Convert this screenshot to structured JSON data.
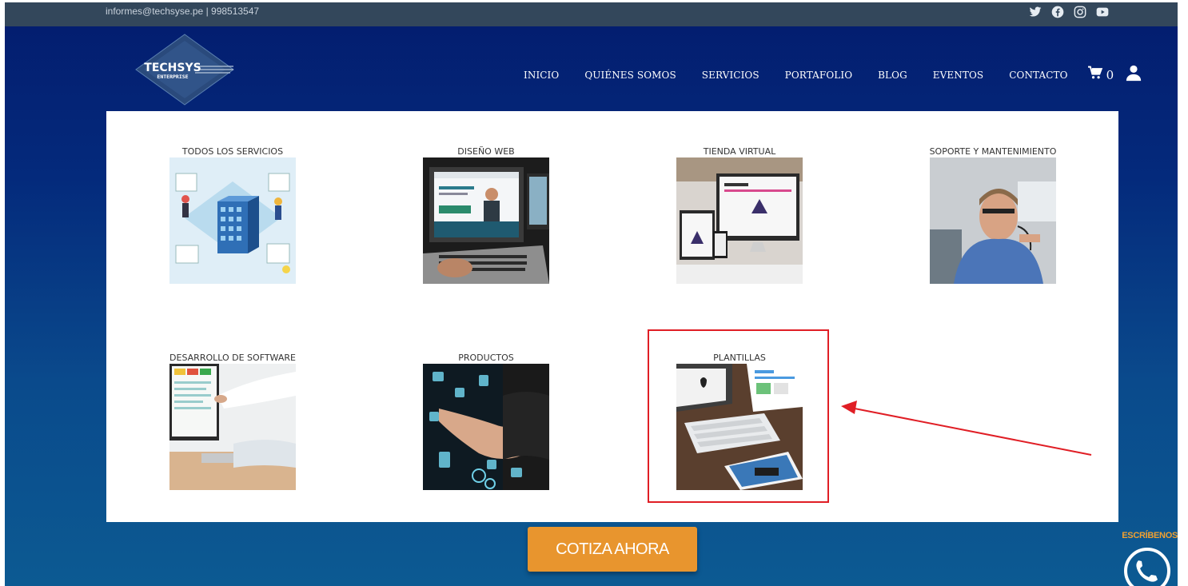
{
  "topbar": {
    "contact": "informes@techsyse.pe | 998513547",
    "social": [
      "twitter-icon",
      "facebook-icon",
      "instagram-icon",
      "youtube-icon"
    ]
  },
  "logo": {
    "line1": "TECHSYS",
    "line2": "ENTERPRISE"
  },
  "nav": {
    "items": [
      "INICIO",
      "QUIÉNES SOMOS",
      "SERVICIOS",
      "PORTAFOLIO",
      "BLOG",
      "EVENTOS",
      "CONTACTO"
    ],
    "cart_count": "0"
  },
  "services": [
    {
      "label": "TODOS LOS SERVICIOS"
    },
    {
      "label": "DISEÑO WEB"
    },
    {
      "label": "TIENDA VIRTUAL"
    },
    {
      "label": "SOPORTE Y MANTENIMIENTO"
    },
    {
      "label": "DESARROLLO DE SOFTWARE"
    },
    {
      "label": "PRODUCTOS"
    },
    {
      "label": "PLANTILLAS"
    }
  ],
  "cta": {
    "label": "COTIZA AHORA"
  },
  "whatsapp": {
    "label": "ESCRÍBENOS"
  },
  "colors": {
    "header_bg": "#031c6e",
    "topbar_bg": "#33475b",
    "cta": "#e8952e",
    "highlight": "#e01e25"
  }
}
